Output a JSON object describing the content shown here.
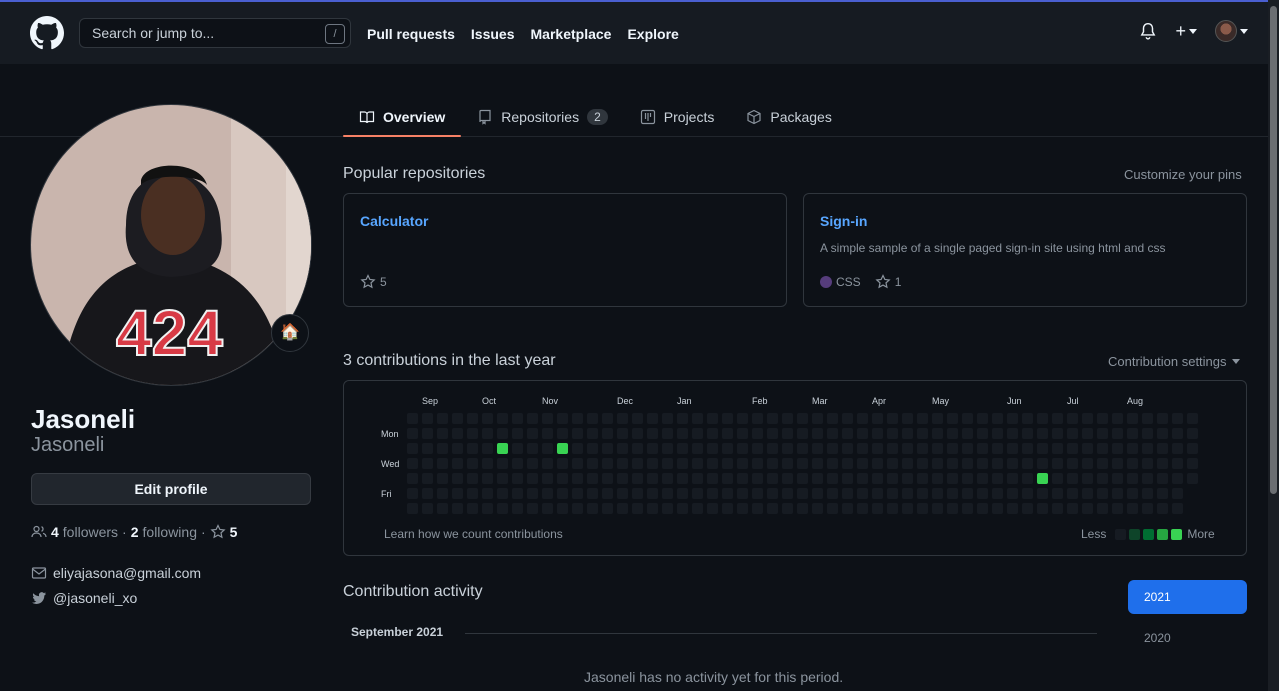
{
  "header": {
    "search_placeholder": "Search or jump to...",
    "search_key": "/",
    "nav": [
      "Pull requests",
      "Issues",
      "Marketplace",
      "Explore"
    ],
    "plus_label": "+"
  },
  "tabs": [
    {
      "label": "Overview",
      "icon": "book-icon",
      "active": true
    },
    {
      "label": "Repositories",
      "icon": "repo-icon",
      "count": "2"
    },
    {
      "label": "Projects",
      "icon": "project-icon"
    },
    {
      "label": "Packages",
      "icon": "package-icon"
    }
  ],
  "profile": {
    "status_emoji": "🏠",
    "name": "Jasoneli",
    "login": "Jasoneli",
    "edit_label": "Edit profile",
    "followers_count": "4",
    "followers_label": "followers",
    "following_count": "2",
    "following_label": "following",
    "stars_count": "5",
    "email": "eliyajasona@gmail.com",
    "twitter": "@jasoneli_xo"
  },
  "popular": {
    "title": "Popular repositories",
    "customize": "Customize your pins",
    "repos": [
      {
        "name": "Calculator",
        "description": "",
        "stars": "5"
      },
      {
        "name": "Sign-in",
        "description": "A simple sample of a single paged sign-in site using html and css",
        "language": "CSS",
        "language_color": "#563d7c",
        "stars": "1"
      }
    ]
  },
  "contributions": {
    "title": "3 contributions in the last year",
    "settings": "Contribution settings",
    "months": [
      "Sep",
      "Oct",
      "Nov",
      "Dec",
      "Jan",
      "Feb",
      "Mar",
      "Apr",
      "May",
      "Jun",
      "Jul",
      "Aug"
    ],
    "days": [
      "Mon",
      "Wed",
      "Fri"
    ],
    "learn": "Learn how we count contributions",
    "less": "Less",
    "more": "More",
    "legend_colors": [
      "#161b22",
      "#0e4429",
      "#006d32",
      "#26a641",
      "#39d353"
    ]
  },
  "activity": {
    "title": "Contribution activity",
    "month": "September 2021",
    "empty": "Jasoneli has no activity yet for this period.",
    "years": [
      "2021",
      "2020"
    ]
  }
}
